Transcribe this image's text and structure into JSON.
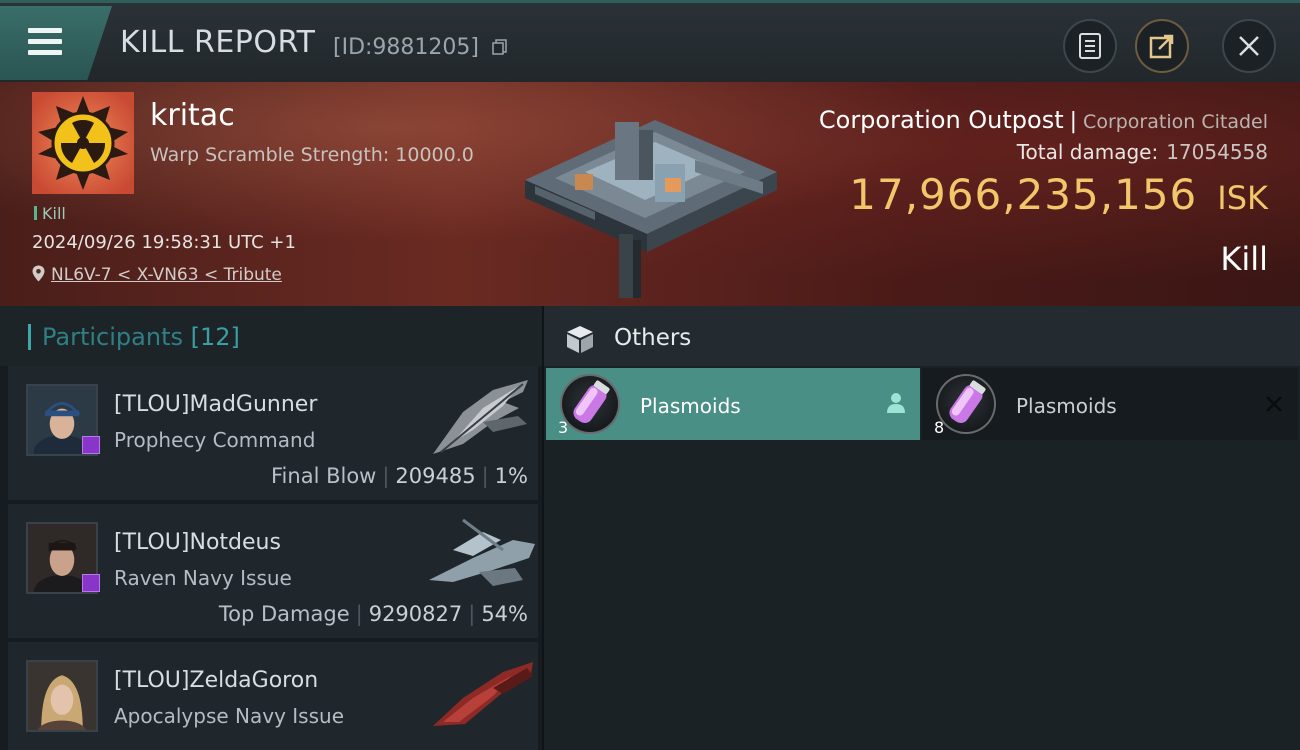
{
  "header": {
    "title": "KILL REPORT",
    "kill_id": "[ID:9881205]",
    "icons": [
      "menu-icon",
      "copy-icon",
      "clipboard-icon",
      "share-icon",
      "close-icon"
    ]
  },
  "victim": {
    "name": "kritac",
    "subtitle": "Warp Scramble Strength: 10000.0",
    "tag": "Kill",
    "datetime": "2024/09/26 19:58:31 UTC +1",
    "location": "NL6V-7 < X-VN63 < Tribute"
  },
  "target": {
    "name": "Corporation Outpost",
    "separator": "|",
    "class": "Corporation Citadel",
    "total_damage_label": "Total damage:",
    "total_damage": "17054558",
    "isk_value": "17,966,235,156",
    "isk_unit": "ISK",
    "kill_label": "Kill"
  },
  "participants": {
    "label": "Participants",
    "count": "[12]",
    "rows": [
      {
        "name": "[TLOU]MadGunner",
        "ship": "Prophecy Command",
        "role": "Final Blow",
        "damage": "209485",
        "percent": "1%"
      },
      {
        "name": "[TLOU]Notdeus",
        "ship": "Raven Navy Issue",
        "role": "Top Damage",
        "damage": "9290827",
        "percent": "54%"
      },
      {
        "name": "[TLOU]ZeldaGoron",
        "ship": "Apocalypse Navy Issue"
      }
    ]
  },
  "others": {
    "label": "Others",
    "items": [
      {
        "name": "Plasmoids",
        "qty": "3",
        "selected": true
      },
      {
        "name": "Plasmoids",
        "qty": "8",
        "selected": false
      }
    ]
  },
  "colors": {
    "accent": "#3fa7a7",
    "isk_gold": "#f2c66a",
    "selected_item": "#4a8f85",
    "banner": "#6a2a22"
  }
}
